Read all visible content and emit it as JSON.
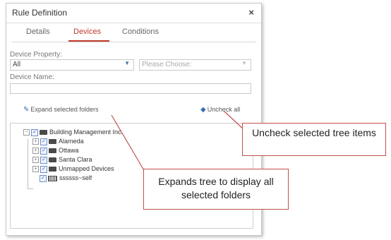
{
  "dialog": {
    "title": "Rule Definition",
    "close_glyph": "×",
    "tabs": [
      {
        "label": "Details"
      },
      {
        "label": "Devices",
        "active": true
      },
      {
        "label": "Conditions"
      }
    ]
  },
  "form": {
    "device_property_label": "Device Property:",
    "device_property_value": "All",
    "please_choose": "Please Choose:",
    "device_name_label": "Device Name:",
    "device_name_value": ""
  },
  "actions": {
    "expand_label": "Expand selected folders",
    "uncheck_label": "Uncheck all"
  },
  "tree": {
    "root": "Building Management Inc.",
    "children": [
      "Alameda",
      "Ottawa",
      "Santa Clara",
      "Unmapped Devices",
      "ssssss~self"
    ]
  },
  "callouts": {
    "uncheck": "Uncheck selected tree items",
    "expand": "Expands tree to display all selected folders"
  },
  "colors": {
    "accent": "#c0392b",
    "callout_border": "#c0504d",
    "checkbox": "#2b5aa8"
  },
  "icons": {
    "close": "close-icon",
    "expand": "pencil-icon",
    "uncheck": "eraser-icon",
    "folder": "folder-icon",
    "device": "device-icon"
  }
}
